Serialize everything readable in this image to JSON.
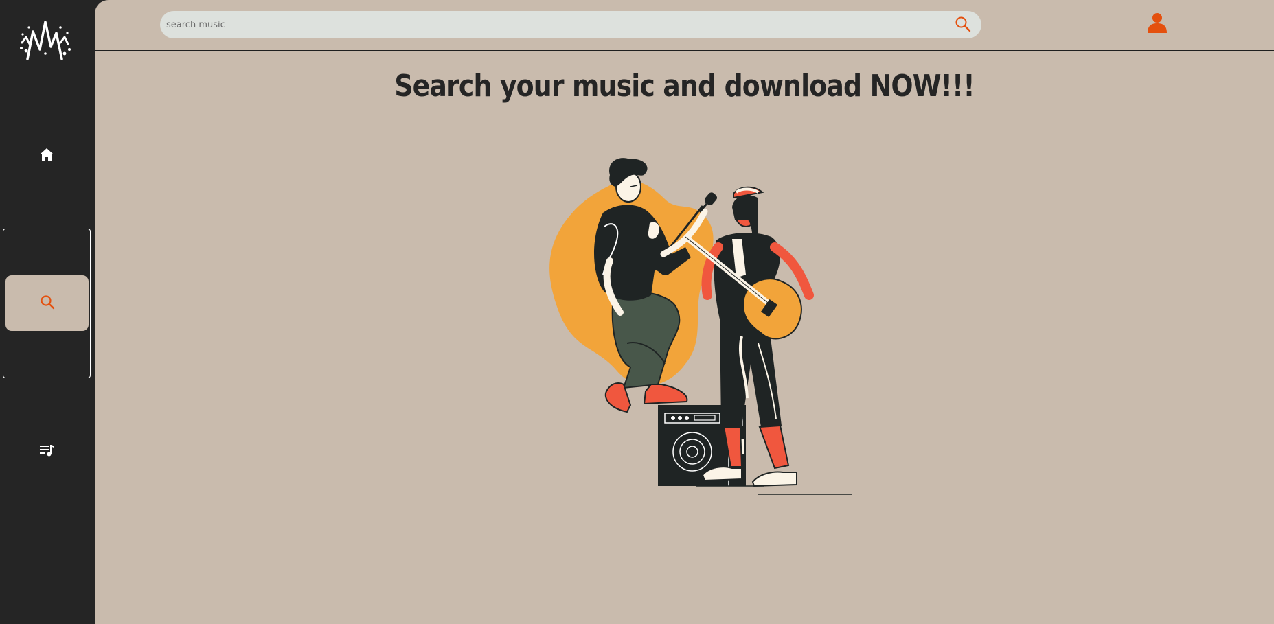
{
  "sidebar": {
    "logo_icon": "music-logo-icon",
    "items": [
      {
        "name": "home",
        "icon": "home-icon"
      },
      {
        "name": "search",
        "icon": "search-icon",
        "active": true
      },
      {
        "name": "playlist",
        "icon": "playlist-icon"
      }
    ]
  },
  "topbar": {
    "search": {
      "placeholder": "search music",
      "value": "",
      "icon": "search-icon"
    },
    "user_icon": "user-icon"
  },
  "main": {
    "headline": "Search your music and download NOW!!!",
    "illustration": "musicians-illustration"
  },
  "colors": {
    "sidebar_bg": "#252525",
    "main_bg": "#c9bbad",
    "accent": "#e4500e",
    "search_bg": "#dde1dd",
    "text_dark": "#252525",
    "illustration_orange": "#f2a43a",
    "illustration_red": "#f0573e",
    "illustration_green": "#48574a"
  }
}
